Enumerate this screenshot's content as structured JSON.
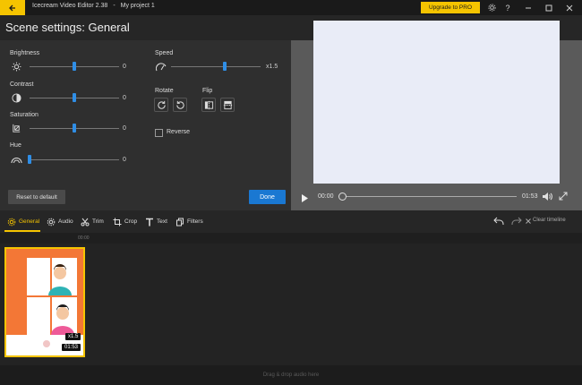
{
  "titlebar": {
    "app_name": "Icecream Video Editor 2.38",
    "separator": "-",
    "project_name": "My project 1",
    "upgrade_label": "Upgrade to PRO"
  },
  "header": {
    "title": "Scene settings: General"
  },
  "settings": {
    "brightness": {
      "label": "Brightness",
      "value": "0",
      "level": 0.5
    },
    "contrast": {
      "label": "Contrast",
      "value": "0",
      "level": 0.5
    },
    "saturation": {
      "label": "Saturation",
      "value": "0",
      "level": 0.5
    },
    "hue": {
      "label": "Hue",
      "value": "0",
      "level": 0.0
    },
    "speed": {
      "label": "Speed",
      "value": "x1.5",
      "level": 0.6
    },
    "rotate_label": "Rotate",
    "flip_label": "Flip",
    "reverse_label": "Reverse",
    "reset_label": "Reset to default",
    "done_label": "Done"
  },
  "player": {
    "current_time": "00:00",
    "duration": "01:53",
    "progress": 0
  },
  "tabs": [
    {
      "label": "General",
      "icon": "gear-icon",
      "active": true
    },
    {
      "label": "Audio",
      "icon": "audio-gear-icon",
      "active": false
    },
    {
      "label": "Trim",
      "icon": "scissors-icon",
      "active": false
    },
    {
      "label": "Crop",
      "icon": "crop-icon",
      "active": false
    },
    {
      "label": "Text",
      "icon": "text-icon",
      "active": false
    },
    {
      "label": "Filters",
      "icon": "filters-icon",
      "active": false
    }
  ],
  "timeline": {
    "clear_label": "Clear timeline",
    "ruler_mark": "00:00",
    "clip": {
      "speed": "x1.5",
      "duration": "01:53"
    },
    "audio_drop_label": "Drag & drop audio here"
  },
  "colors": {
    "accent": "#f5c400",
    "primary_button": "#1a78d2",
    "slider_thumb": "#2f8ee6"
  }
}
